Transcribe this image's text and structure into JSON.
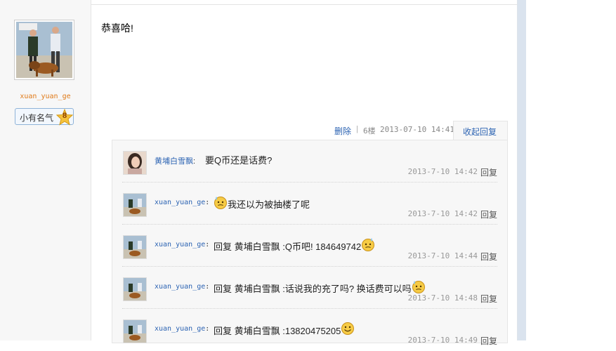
{
  "user": {
    "name": "xuan_yuan_ge",
    "badge_label": "小有名气",
    "badge_level": "8"
  },
  "post": {
    "text": "恭喜哈!",
    "delete_label": "删除",
    "separator": "|",
    "floor": "6楼",
    "date": "2013-07-10 14:41",
    "collapse_label": "收起回复"
  },
  "replies": [
    {
      "author": "黄埔白雪飘",
      "colon": ":",
      "content": "要Q币还是话费?",
      "emoji": "",
      "time": "2013-7-10 14:42",
      "reply_label": "回复"
    },
    {
      "author": "xuan_yuan_ge",
      "colon": ":",
      "content": "我还以为被抽楼了呢",
      "emoji": "sweat-face-icon",
      "time": "2013-7-10 14:42",
      "reply_label": "回复"
    },
    {
      "author": "xuan_yuan_ge",
      "colon": ":",
      "content": "回复 黄埔白雪飘 :Q币吧! 184649742",
      "emoji": "sweat-face-icon",
      "time": "2013-7-10 14:44",
      "reply_label": "回复"
    },
    {
      "author": "xuan_yuan_ge",
      "colon": ":",
      "content": "回复 黄埔白雪飘 :话说我的充了吗? 换话费可以吗",
      "emoji": "sweat-face-icon",
      "time": "2013-7-10 14:48",
      "reply_label": "回复"
    },
    {
      "author": "xuan_yuan_ge",
      "colon": ":",
      "content": "回复 黄埔白雪飘 :13820475205",
      "emoji": "smile-face-icon",
      "time": "2013-7-10 14:49",
      "reply_label": "回复"
    }
  ],
  "colors": {
    "link": "#2d64b3",
    "username_orange": "#e07b1a",
    "sidebar_bg": "#f7f7f7"
  }
}
